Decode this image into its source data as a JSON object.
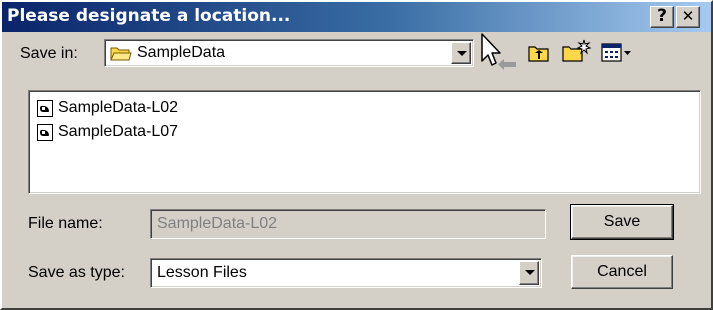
{
  "window": {
    "title": "Please designate a location...",
    "help_label": "?",
    "close_label": "✕"
  },
  "save_in": {
    "label": "Save in:",
    "value": "SampleData"
  },
  "toolbar": {
    "icons": [
      "back-icon",
      "up-folder-icon",
      "new-folder-icon",
      "view-menu-icon"
    ]
  },
  "files": [
    {
      "name": "SampleData-L02"
    },
    {
      "name": "SampleData-L07"
    }
  ],
  "file_name": {
    "label": "File name:",
    "value": "SampleData-L02"
  },
  "save_as_type": {
    "label": "Save as type:",
    "value": "Lesson Files"
  },
  "buttons": {
    "save_label": "Save",
    "cancel_label": "Cancel"
  },
  "colors": {
    "title_gradient_start": "#0a246a",
    "title_gradient_end": "#a6caf0",
    "face": "#d4d0c8",
    "folder": "#ffd84a"
  }
}
